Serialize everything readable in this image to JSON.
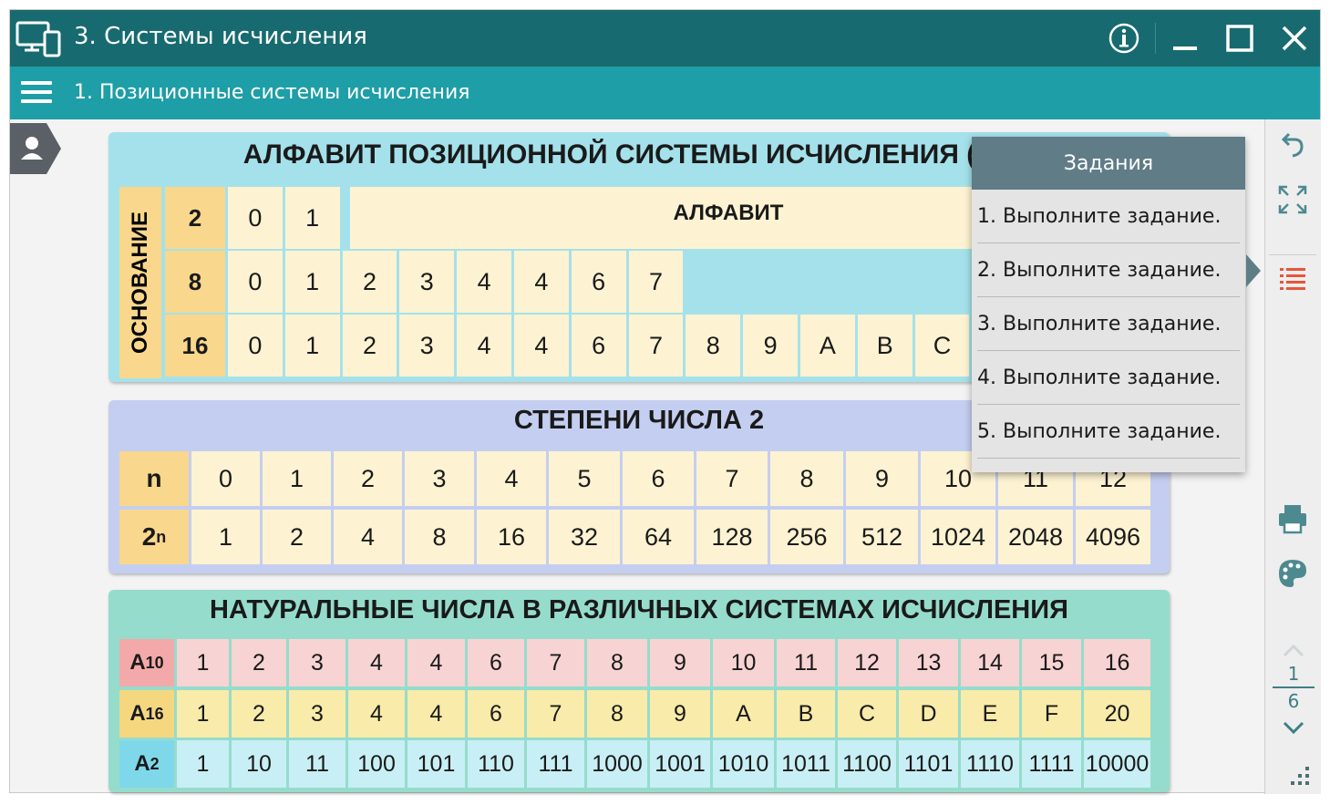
{
  "titlebar": {
    "title": "3. Системы исчисления"
  },
  "subbar": {
    "title": "1. Позиционные системы исчисления"
  },
  "panel1": {
    "title": "АЛФАВИТ ПОЗИЦИОННОЙ СИСТЕМЫ ИСЧИСЛЕНИЯ (2,",
    "side_label": "ОСНОВАНИЕ",
    "alphabet_label": "АЛФАВИТ",
    "rows": [
      {
        "base": "2",
        "digits": [
          "0",
          "1"
        ]
      },
      {
        "base": "8",
        "digits": [
          "0",
          "1",
          "2",
          "3",
          "4",
          "4",
          "6",
          "7"
        ]
      },
      {
        "base": "16",
        "digits": [
          "0",
          "1",
          "2",
          "3",
          "4",
          "4",
          "6",
          "7",
          "8",
          "9",
          "A",
          "B",
          "C"
        ]
      }
    ]
  },
  "panel2": {
    "title": "СТЕПЕНИ ЧИСЛА 2",
    "row_n_label": "n",
    "row_pow_base": "2",
    "row_pow_exp": "n",
    "n": [
      "0",
      "1",
      "2",
      "3",
      "4",
      "5",
      "6",
      "7",
      "8",
      "9",
      "10",
      "11",
      "12"
    ],
    "pow": [
      "1",
      "2",
      "4",
      "8",
      "16",
      "32",
      "64",
      "128",
      "256",
      "512",
      "1024",
      "2048",
      "4096"
    ]
  },
  "panel3": {
    "title": "НАТУРАЛЬНЫЕ ЧИСЛА В РАЗЛИЧНЫХ СИСТЕМАХ ИСЧИСЛЕНИЯ",
    "rows": [
      {
        "label": "A",
        "sub": "10",
        "values": [
          "1",
          "2",
          "3",
          "4",
          "4",
          "6",
          "7",
          "8",
          "9",
          "10",
          "11",
          "12",
          "13",
          "14",
          "15",
          "16"
        ]
      },
      {
        "label": "A",
        "sub": "16",
        "values": [
          "1",
          "2",
          "3",
          "4",
          "4",
          "6",
          "7",
          "8",
          "9",
          "A",
          "B",
          "C",
          "D",
          "E",
          "F",
          "20"
        ]
      },
      {
        "label": "A",
        "sub": "2",
        "values": [
          "1",
          "10",
          "11",
          "100",
          "101",
          "110",
          "111",
          "1000",
          "1001",
          "1010",
          "1011",
          "1100",
          "1101",
          "1110",
          "1111",
          "10000"
        ]
      }
    ]
  },
  "tasks": {
    "header": "Задания",
    "items": [
      "1. Выполните задание.",
      "2. Выполните задание.",
      "3. Выполните задание.",
      "4. Выполните задание.",
      "5. Выполните задание."
    ]
  },
  "pager": {
    "current": "1",
    "total": "6"
  },
  "colors": {
    "titlebar": "#176b70",
    "subbar": "#1e9ea6",
    "accent": "#3d7f86"
  }
}
